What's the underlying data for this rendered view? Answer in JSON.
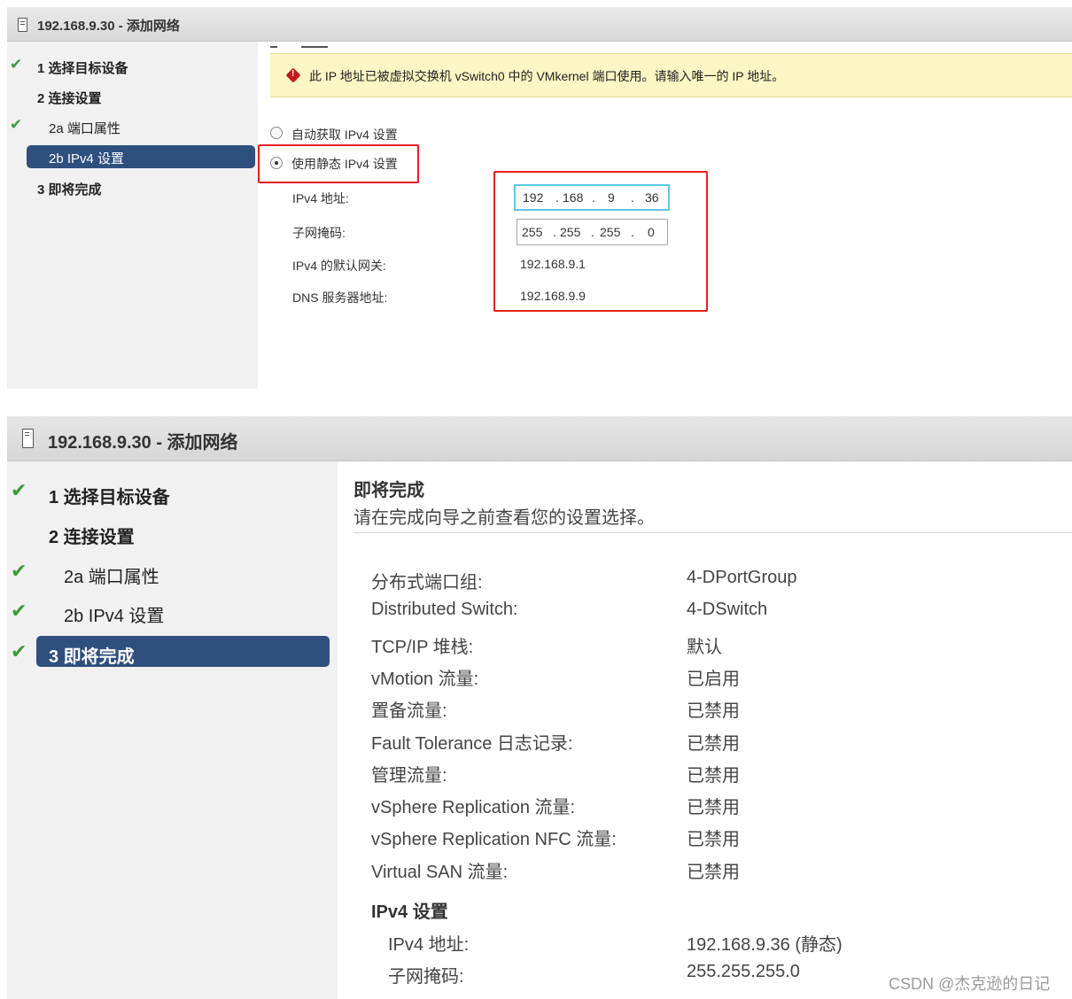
{
  "panel1": {
    "title": "192.168.9.30 - 添加网络",
    "steps": [
      {
        "label": "1  选择目标设备",
        "checked": true
      },
      {
        "label": "2  连接设置",
        "checked": false
      },
      {
        "label": "2a 端口属性",
        "checked": true
      },
      {
        "label": "2b IPv4 设置",
        "checked": false,
        "selected": true
      },
      {
        "label": "3  即将完成",
        "checked": false
      }
    ],
    "warning": "此 IP 地址已被虚拟交换机 vSwitch0 中的 VMkernel 端口使用。请输入唯一的 IP 地址。",
    "radio_auto": "自动获取 IPv4 设置",
    "radio_static": "使用静态 IPv4 设置",
    "fields": {
      "ipv4_label": "IPv4 地址:",
      "ipv4_octets": [
        "192",
        "168",
        "9",
        "36"
      ],
      "mask_label": "子网掩码:",
      "mask_octets": [
        "255",
        "255",
        "255",
        "0"
      ],
      "gateway_label": "IPv4 的默认网关:",
      "gateway_value": "192.168.9.1",
      "dns_label": "DNS 服务器地址:",
      "dns_value": "192.168.9.9"
    }
  },
  "panel2": {
    "title": "192.168.9.30 - 添加网络",
    "steps": [
      {
        "label": "1  选择目标设备",
        "checked": true
      },
      {
        "label": "2  连接设置",
        "checked": false
      },
      {
        "label": "2a 端口属性",
        "checked": true
      },
      {
        "label": "2b IPv4 设置",
        "checked": true
      },
      {
        "label": "3  即将完成",
        "checked": true,
        "selected": true
      }
    ],
    "heading": "即将完成",
    "subheading": "请在完成向导之前查看您的设置选择。",
    "summary": [
      {
        "label": "分布式端口组:",
        "value": "4-DPortGroup"
      },
      {
        "label": "Distributed Switch:",
        "value": "4-DSwitch"
      },
      {
        "label": "TCP/IP 堆栈:",
        "value": "默认"
      },
      {
        "label": "vMotion 流量:",
        "value": "已启用"
      },
      {
        "label": "置备流量:",
        "value": "已禁用"
      },
      {
        "label": "Fault Tolerance 日志记录:",
        "value": "已禁用"
      },
      {
        "label": "管理流量:",
        "value": "已禁用"
      },
      {
        "label": "vSphere Replication 流量:",
        "value": "已禁用"
      },
      {
        "label": "vSphere Replication NFC 流量:",
        "value": "已禁用"
      },
      {
        "label": "Virtual SAN 流量:",
        "value": "已禁用"
      }
    ],
    "ipv4_section": "IPv4 设置",
    "ipv4_rows": [
      {
        "label": "IPv4 地址:",
        "value": "192.168.9.36 (静态)"
      },
      {
        "label": "子网掩码:",
        "value": "255.255.255.0"
      }
    ]
  },
  "watermark": "CSDN @杰克逊的日记",
  "colors": {
    "accent_selected": "#2f4f7f",
    "check": "#3a9a3a",
    "highlight_red": "#e8201b",
    "warning_bg": "#fbf6c3"
  }
}
